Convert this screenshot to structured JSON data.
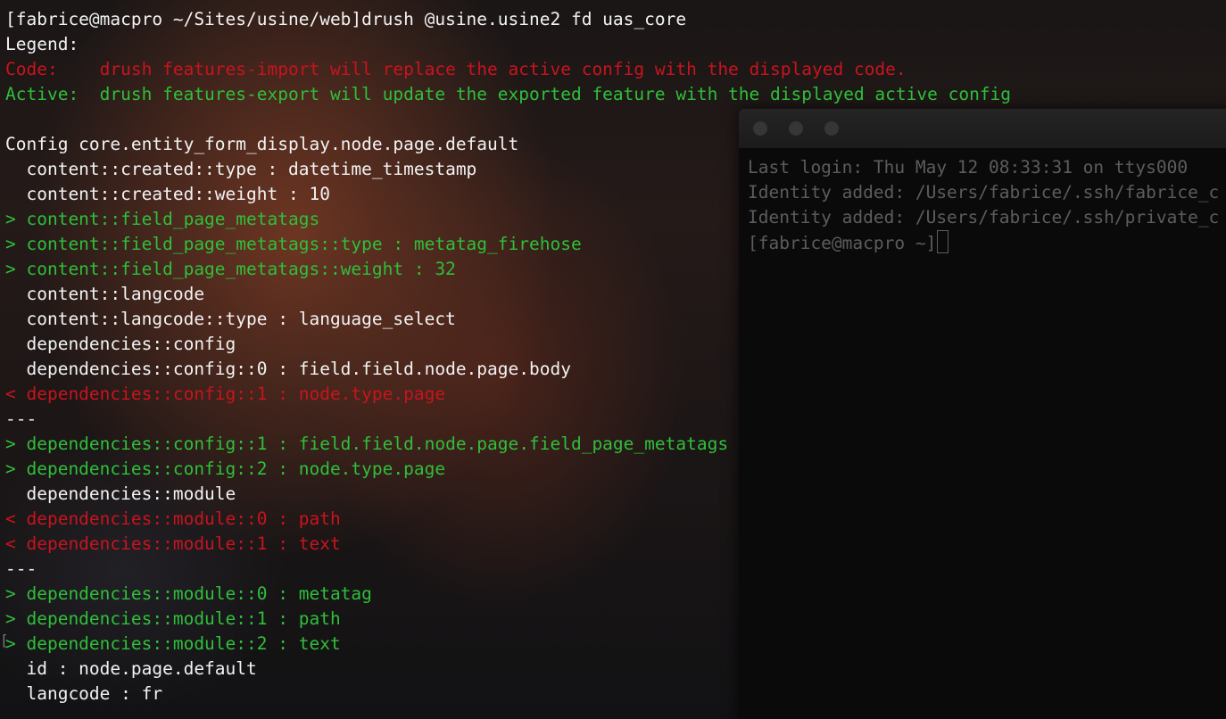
{
  "main_terminal": {
    "lines": [
      {
        "text": "[fabrice@macpro ~/Sites/usine/web]drush @usine.usine2 fd uas_core",
        "color": "#f2f2f2"
      },
      {
        "text": "Legend:",
        "color": "#f2f2f2"
      },
      {
        "text": "Code:    drush features-import will replace the active config with the displayed code.",
        "color": "#c8141e"
      },
      {
        "text": "Active:  drush features-export will update the exported feature with the displayed active config",
        "color": "#2fbf3a"
      },
      {
        "text": "",
        "color": "#f2f2f2"
      },
      {
        "text": "Config core.entity_form_display.node.page.default",
        "color": "#f2f2f2"
      },
      {
        "text": "  content::created::type : datetime_timestamp",
        "color": "#f2f2f2"
      },
      {
        "text": "  content::created::weight : 10",
        "color": "#f2f2f2"
      },
      {
        "text": "> content::field_page_metatags",
        "color": "#2fbf3a"
      },
      {
        "text": "> content::field_page_metatags::type : metatag_firehose",
        "color": "#2fbf3a"
      },
      {
        "text": "> content::field_page_metatags::weight : 32",
        "color": "#2fbf3a"
      },
      {
        "text": "  content::langcode",
        "color": "#f2f2f2"
      },
      {
        "text": "  content::langcode::type : language_select",
        "color": "#f2f2f2"
      },
      {
        "text": "  dependencies::config",
        "color": "#f2f2f2"
      },
      {
        "text": "  dependencies::config::0 : field.field.node.page.body",
        "color": "#f2f2f2"
      },
      {
        "text": "< dependencies::config::1 : node.type.page",
        "color": "#c8141e"
      },
      {
        "text": "---",
        "color": "#f2f2f2"
      },
      {
        "text": "> dependencies::config::1 : field.field.node.page.field_page_metatags",
        "color": "#2fbf3a"
      },
      {
        "text": "> dependencies::config::2 : node.type.page",
        "color": "#2fbf3a"
      },
      {
        "text": "  dependencies::module",
        "color": "#f2f2f2"
      },
      {
        "text": "< dependencies::module::0 : path",
        "color": "#c8141e"
      },
      {
        "text": "< dependencies::module::1 : text",
        "color": "#c8141e"
      },
      {
        "text": "---",
        "color": "#f2f2f2"
      },
      {
        "text": "> dependencies::module::0 : metatag",
        "color": "#2fbf3a"
      },
      {
        "text": "> dependencies::module::1 : path",
        "color": "#2fbf3a"
      },
      {
        "text": "> dependencies::module::2 : text",
        "color": "#2fbf3a"
      },
      {
        "text": "  id : node.page.default",
        "color": "#f2f2f2"
      },
      {
        "text": "  langcode : fr",
        "color": "#f2f2f2"
      }
    ]
  },
  "background_terminal": {
    "lines": [
      "Last login: Thu May 12 08:33:31 on ttys000",
      "Identity added: /Users/fabrice/.ssh/fabrice_c",
      "Identity added: /Users/fabrice/.ssh/private_c",
      "[fabrice@macpro ~]"
    ]
  },
  "colors": {
    "code_red": "#c8141e",
    "active_green": "#2fbf3a",
    "text_white": "#f2f2f2",
    "dim_gray": "#5c5c5c"
  }
}
